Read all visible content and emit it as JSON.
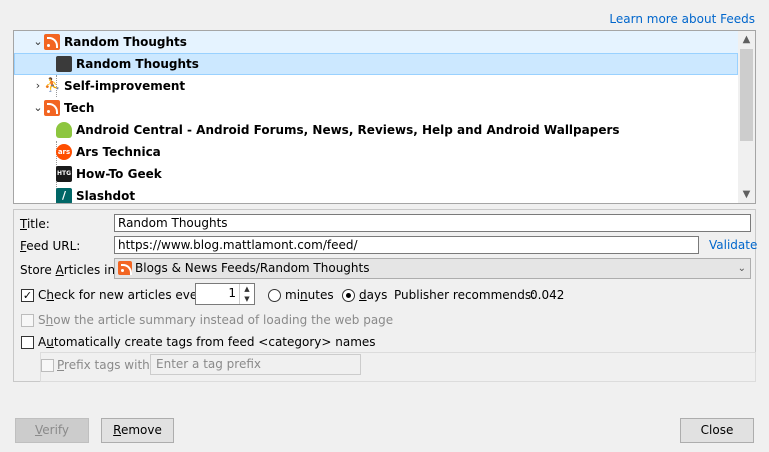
{
  "header": {
    "learn_more": "Learn more about Feeds"
  },
  "tree": {
    "items": [
      {
        "label": "Random Thoughts",
        "toggle": "⌄"
      },
      {
        "label": "Random Thoughts"
      },
      {
        "label": "Self-improvement",
        "toggle": "›"
      },
      {
        "label": "Tech",
        "toggle": "⌄"
      },
      {
        "label": "Android Central - Android Forums, News, Reviews, Help and Android Wallpapers"
      },
      {
        "label": "Ars Technica",
        "icon_text": "ars"
      },
      {
        "label": "How-To Geek",
        "icon_text": "HTG"
      },
      {
        "label": "Slashdot",
        "icon_text": "/"
      }
    ]
  },
  "form": {
    "title_label_u": "T",
    "title_label_rest": "itle:",
    "title_value": "Random Thoughts",
    "feed_url_label_u": "F",
    "feed_url_label_rest": "eed URL:",
    "feed_url_value": "https://www.blog.mattlamont.com/feed/",
    "validate": "Validate",
    "store_label_pre": "Store ",
    "store_label_u": "A",
    "store_label_rest": "rticles in:",
    "store_value": "Blogs & News Feeds/Random Thoughts",
    "check_pre": "C",
    "check_u": "h",
    "check_rest": "eck for new articles every",
    "check_checked": "✓",
    "interval_value": "1",
    "minutes_label_pre": "mi",
    "minutes_label_u": "n",
    "minutes_label_rest": "utes",
    "days_label_u": "d",
    "days_label_rest": "ays",
    "publisher_label": "Publisher recommends:",
    "publisher_value": "0.042",
    "summary_pre": "S",
    "summary_u": "h",
    "summary_rest": "ow the article summary instead of loading the web page",
    "tags_pre": "A",
    "tags_u": "u",
    "tags_rest": "tomatically create tags from feed <category> names",
    "prefix_label_u": "P",
    "prefix_label_rest": "refix tags with:",
    "prefix_placeholder": "Enter a tag prefix"
  },
  "buttons": {
    "verify_u": "V",
    "verify_rest": "erify",
    "remove_u": "R",
    "remove_rest": "emove",
    "close": "Close"
  }
}
